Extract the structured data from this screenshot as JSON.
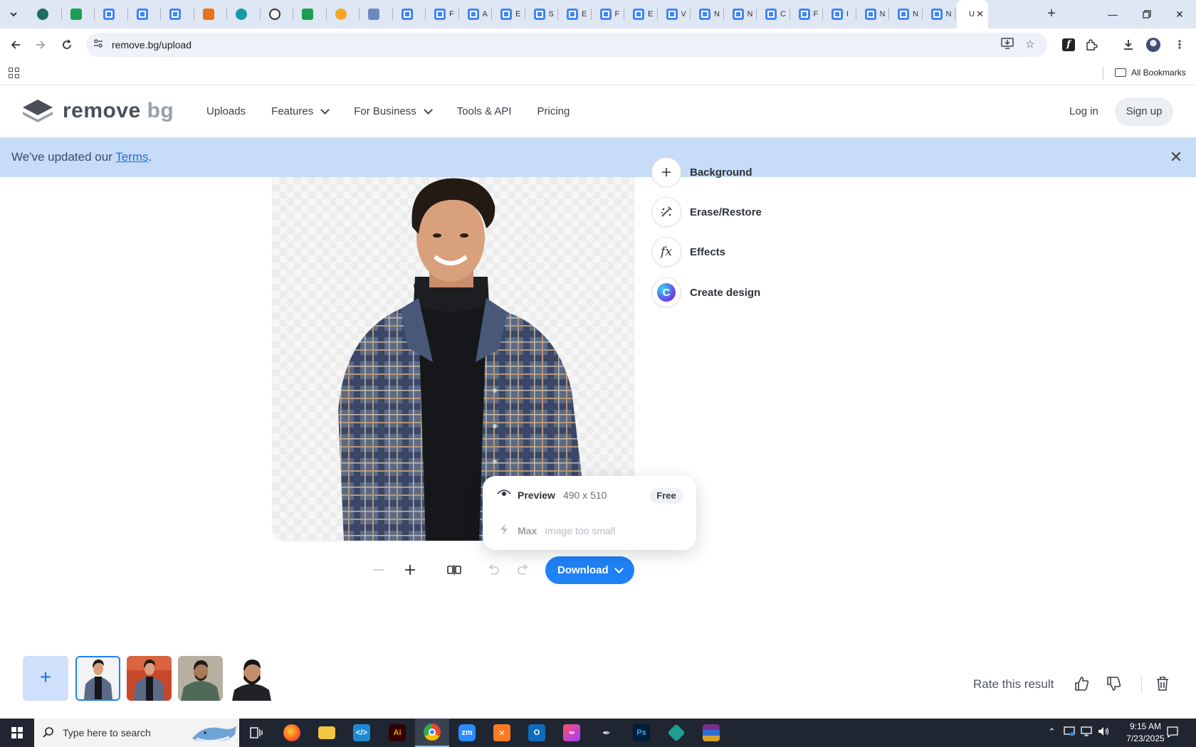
{
  "browser": {
    "url": "remove.bg/upload",
    "tabs": [
      {
        "icon": "vpn-icon",
        "title": ""
      },
      {
        "icon": "sheets-icon",
        "title": ""
      },
      {
        "icon": "docs-icon",
        "title": ""
      },
      {
        "icon": "docs-icon",
        "title": ""
      },
      {
        "icon": "docs-icon",
        "title": ""
      },
      {
        "icon": "xampp-icon",
        "title": ""
      },
      {
        "icon": "teal-app-icon",
        "title": ""
      },
      {
        "icon": "chatgpt-icon",
        "title": ""
      },
      {
        "icon": "sheets-icon",
        "title": ""
      },
      {
        "icon": "hand-icon",
        "title": ""
      },
      {
        "icon": "grid-app-icon",
        "title": ""
      },
      {
        "icon": "form-icon",
        "title": ""
      },
      {
        "icon": "form-icon",
        "title": "F"
      },
      {
        "icon": "form-icon",
        "title": "A"
      },
      {
        "icon": "form-icon",
        "title": "E"
      },
      {
        "icon": "form-icon",
        "title": "S"
      },
      {
        "icon": "form-icon",
        "title": "E"
      },
      {
        "icon": "form-icon",
        "title": "F"
      },
      {
        "icon": "form-icon",
        "title": "E"
      },
      {
        "icon": "form-icon",
        "title": "V"
      },
      {
        "icon": "form-icon",
        "title": "N"
      },
      {
        "icon": "form-icon",
        "title": "N"
      },
      {
        "icon": "form-icon",
        "title": "C"
      },
      {
        "icon": "form-icon",
        "title": "F"
      },
      {
        "icon": "form-icon",
        "title": "I"
      },
      {
        "icon": "form-icon",
        "title": "N"
      },
      {
        "icon": "form-icon",
        "title": "N"
      },
      {
        "icon": "form-icon",
        "title": "N"
      }
    ],
    "active_tab_title": "U",
    "bookmarks_label": "All Bookmarks"
  },
  "site": {
    "logo_word1": "remove",
    "logo_word2": "bg",
    "nav": [
      {
        "label": "Uploads",
        "has_menu": false
      },
      {
        "label": "Features",
        "has_menu": true
      },
      {
        "label": "For Business",
        "has_menu": true
      },
      {
        "label": "Tools & API",
        "has_menu": false
      },
      {
        "label": "Pricing",
        "has_menu": false
      }
    ],
    "login_label": "Log in",
    "signup_label": "Sign up"
  },
  "banner": {
    "text_before": "We've updated our ",
    "link_text": "Terms",
    "text_after": "."
  },
  "editor": {
    "tools": [
      {
        "icon": "plus-icon",
        "label": "Background"
      },
      {
        "icon": "erase-restore-icon",
        "label": "Erase/Restore"
      },
      {
        "icon": "fx-icon",
        "label": "Effects"
      },
      {
        "icon": "canva-icon",
        "label": "Create design"
      }
    ],
    "download_label": "Download",
    "popup": {
      "preview_label": "Preview",
      "preview_size": "490 x 510",
      "preview_badge": "Free",
      "max_label": "Max",
      "max_note": "Image too small"
    }
  },
  "bottom": {
    "rate_label": "Rate this result"
  },
  "taskbar": {
    "search_placeholder": "Type here to search",
    "time": "9:15 AM",
    "date": "7/23/2025",
    "apps": [
      "firefox-icon",
      "file-explorer-icon",
      "vscode-icon",
      "illustrator-icon",
      "chrome-icon",
      "zoom-icon",
      "xampp-icon",
      "outlook-icon",
      "creative-cloud-icon",
      "pen-tool-icon",
      "photoshop-icon",
      "vpn-icon",
      "winrar-icon"
    ]
  },
  "colors": {
    "accent_blue": "#1e82f5",
    "banner_bg": "#c7dcf7",
    "tabstrip_bg": "#dfe7f5",
    "taskbar_bg": "#1f2631"
  }
}
